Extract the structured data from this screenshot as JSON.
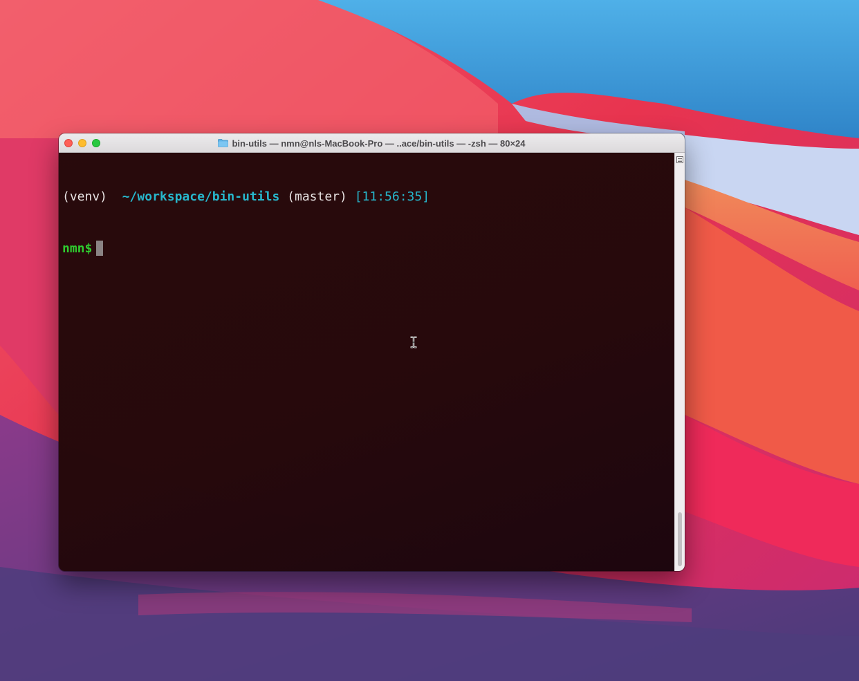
{
  "window": {
    "title": "bin-utils — nmn@nls-MacBook-Pro — ..ace/bin-utils — -zsh — 80×24",
    "title_icon": "folder-icon",
    "controls": [
      "close",
      "minimize",
      "zoom"
    ]
  },
  "terminal": {
    "line1": {
      "venv": "(venv)",
      "path": "~/workspace/bin-utils",
      "branch": "(master)",
      "time": "[11:56:35]"
    },
    "line2": {
      "prompt": "nmn$"
    }
  },
  "colors": {
    "prompt_green": "#2fcc2f",
    "path_cyan": "#27b7cc",
    "terminal_bg": "#260a0d",
    "text": "#e8e3e3"
  },
  "cursor": "i-beam-cursor"
}
